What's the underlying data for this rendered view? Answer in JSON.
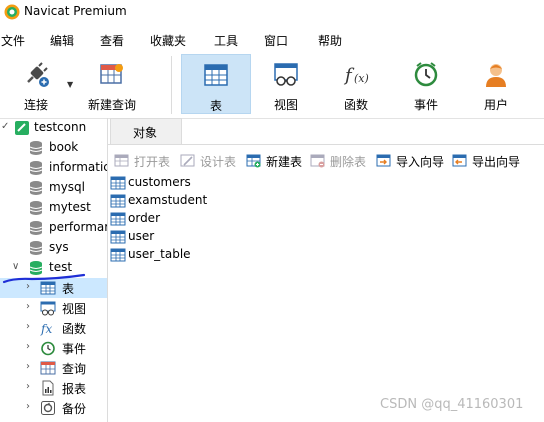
{
  "window": {
    "title": "Navicat Premium"
  },
  "menu": [
    "文件",
    "编辑",
    "查看",
    "收藏夹",
    "工具",
    "窗口",
    "帮助"
  ],
  "toolbar": {
    "buttons": [
      {
        "label": "连接",
        "icon": "connect-plug-icon"
      },
      {
        "label": "新建查询",
        "icon": "new-query-icon"
      },
      {
        "label": "表",
        "icon": "table-icon",
        "active": true
      },
      {
        "label": "视图",
        "icon": "view-icon"
      },
      {
        "label": "函数",
        "icon": "function-icon"
      },
      {
        "label": "事件",
        "icon": "event-clock-icon"
      },
      {
        "label": "用户",
        "icon": "user-icon"
      }
    ]
  },
  "sidebar": {
    "connection": "testconn",
    "databases": [
      "book",
      "informatic",
      "mysql",
      "mytest",
      "performar",
      "sys",
      "test"
    ],
    "children": [
      "表",
      "视图",
      "函数",
      "事件",
      "查询",
      "报表",
      "备份"
    ]
  },
  "tabs": {
    "objects": "对象"
  },
  "object_toolbar": {
    "open": "打开表",
    "design": "设计表",
    "new": "新建表",
    "delete": "删除表",
    "import": "导入向导",
    "export": "导出向导"
  },
  "tables": [
    "customers",
    "examstudent",
    "order",
    "user",
    "user_table"
  ],
  "watermark": "CSDN @qq_41160301",
  "colors": {
    "selected": "#cce8ff",
    "active_tool": "#cce4f7",
    "annotation": "#1f2fd6"
  }
}
